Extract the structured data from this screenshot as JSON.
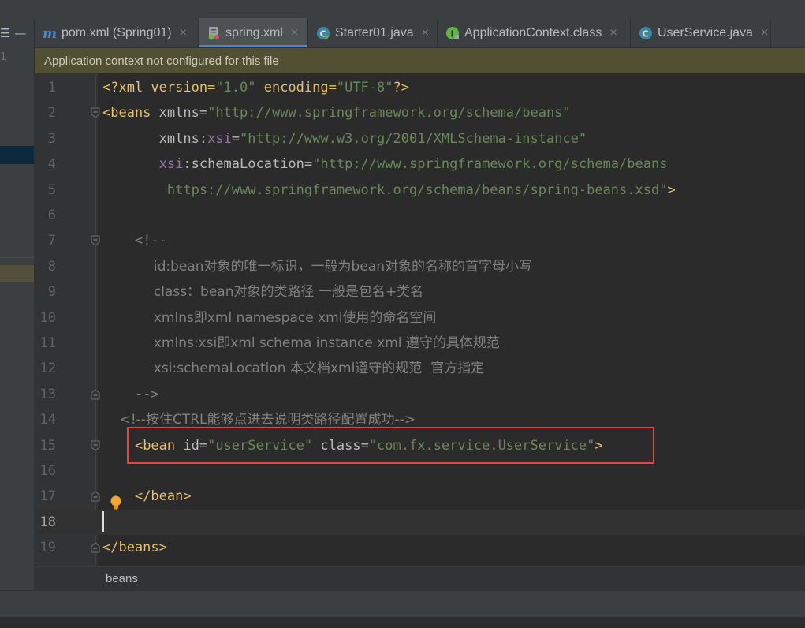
{
  "left_panel": {
    "button_label": "☰ —",
    "line_label": "1"
  },
  "tabs": [
    {
      "icon": "maven-m-icon",
      "title": "pom.xml (Spring01)",
      "active": false
    },
    {
      "icon": "spring-xml-icon",
      "title": "spring.xml",
      "active": true
    },
    {
      "icon": "java-class-icon",
      "title": "Starter01.java",
      "active": false
    },
    {
      "icon": "interface-icon",
      "title": "ApplicationContext.class",
      "active": false
    },
    {
      "icon": "java-class-icon",
      "title": "UserService.java",
      "active": false
    }
  ],
  "tab_close_glyph": "×",
  "notification": "Application context not configured for this file",
  "current_line": 18,
  "highlighted_line": 15,
  "lines": [
    {
      "n": "1",
      "segments": [
        [
          "tag",
          "<?xml version="
        ],
        [
          "val",
          "\"1.0\""
        ],
        [
          "tag",
          " encoding="
        ],
        [
          "val",
          "\"UTF-8\""
        ],
        [
          "tag",
          "?>"
        ]
      ]
    },
    {
      "n": "2",
      "fold": "open",
      "segments": [
        [
          "tag",
          "<beans "
        ],
        [
          "attr",
          "xmlns="
        ],
        [
          "val",
          "\"http://www.springframework.org/schema/beans\""
        ]
      ]
    },
    {
      "n": "3",
      "segments": [
        [
          "plain",
          "       "
        ],
        [
          "attr",
          "xmlns:"
        ],
        [
          "ns",
          "xsi"
        ],
        [
          "attr",
          "="
        ],
        [
          "val",
          "\"http://www.w3.org/2001/XMLSchema-instance\""
        ]
      ]
    },
    {
      "n": "4",
      "segments": [
        [
          "plain",
          "       "
        ],
        [
          "ns",
          "xsi"
        ],
        [
          "attr",
          ":schemaLocation="
        ],
        [
          "val",
          "\"http://www.springframework.org/schema/beans"
        ]
      ]
    },
    {
      "n": "5",
      "segments": [
        [
          "plain",
          "        "
        ],
        [
          "val",
          "https://www.springframework.org/schema/beans/spring-beans.xsd\""
        ],
        [
          "tag",
          ">"
        ]
      ]
    },
    {
      "n": "6",
      "segments": []
    },
    {
      "n": "7",
      "fold": "open",
      "segments": [
        [
          "plain",
          "    "
        ],
        [
          "com",
          "<!--"
        ]
      ]
    },
    {
      "n": "8",
      "cjk": true,
      "segments": [
        [
          "plain",
          "            "
        ],
        [
          "com",
          "id:bean对象的唯一标识，一般为bean对象的名称的首字母小写"
        ]
      ]
    },
    {
      "n": "9",
      "cjk": true,
      "segments": [
        [
          "plain",
          "            "
        ],
        [
          "com",
          "class：bean对象的类路径 一般是包名+类名"
        ]
      ]
    },
    {
      "n": "10",
      "cjk": true,
      "segments": [
        [
          "plain",
          "            "
        ],
        [
          "com",
          "xmlns即xml namespace xml使用的命名空间"
        ]
      ]
    },
    {
      "n": "11",
      "cjk": true,
      "segments": [
        [
          "plain",
          "            "
        ],
        [
          "com",
          "xmlns:xsi即xml schema instance xml 遵守的具体规范"
        ]
      ]
    },
    {
      "n": "12",
      "cjk": true,
      "segments": [
        [
          "plain",
          "            "
        ],
        [
          "com",
          "xsi:schemaLocation 本文档xml遵守的规范  官方指定"
        ]
      ]
    },
    {
      "n": "13",
      "fold": "close",
      "segments": [
        [
          "plain",
          "    "
        ],
        [
          "com",
          "-->"
        ]
      ]
    },
    {
      "n": "14",
      "cjk": true,
      "segments": [
        [
          "plain",
          "    "
        ],
        [
          "com",
          "<!--按住CTRL能够点进去说明类路径配置成功-->"
        ]
      ]
    },
    {
      "n": "15",
      "fold": "open",
      "segments": [
        [
          "plain",
          "    "
        ],
        [
          "tag",
          "<bean "
        ],
        [
          "attr",
          "id="
        ],
        [
          "val",
          "\"userService\""
        ],
        [
          "attr",
          " class="
        ],
        [
          "val",
          "\"com.fx.service.UserService\""
        ],
        [
          "tag",
          ">"
        ]
      ]
    },
    {
      "n": "16",
      "segments": []
    },
    {
      "n": "17",
      "fold": "close",
      "bulb": true,
      "segments": [
        [
          "plain",
          "    "
        ],
        [
          "tag",
          "</bean>"
        ]
      ]
    },
    {
      "n": "18",
      "segments": []
    },
    {
      "n": "19",
      "fold": "close",
      "segments": [
        [
          "tag",
          "</beans>"
        ]
      ]
    }
  ],
  "breadcrumb": "beans",
  "colors": {
    "tag": "#e8bf6a",
    "attr": "#bababa",
    "namespace": "#9876aa",
    "value": "#6a8759",
    "comment": "#808080",
    "highlight_box": "#e0483c",
    "notification_bg": "#525032",
    "active_tab_underline": "#4a88c7"
  }
}
